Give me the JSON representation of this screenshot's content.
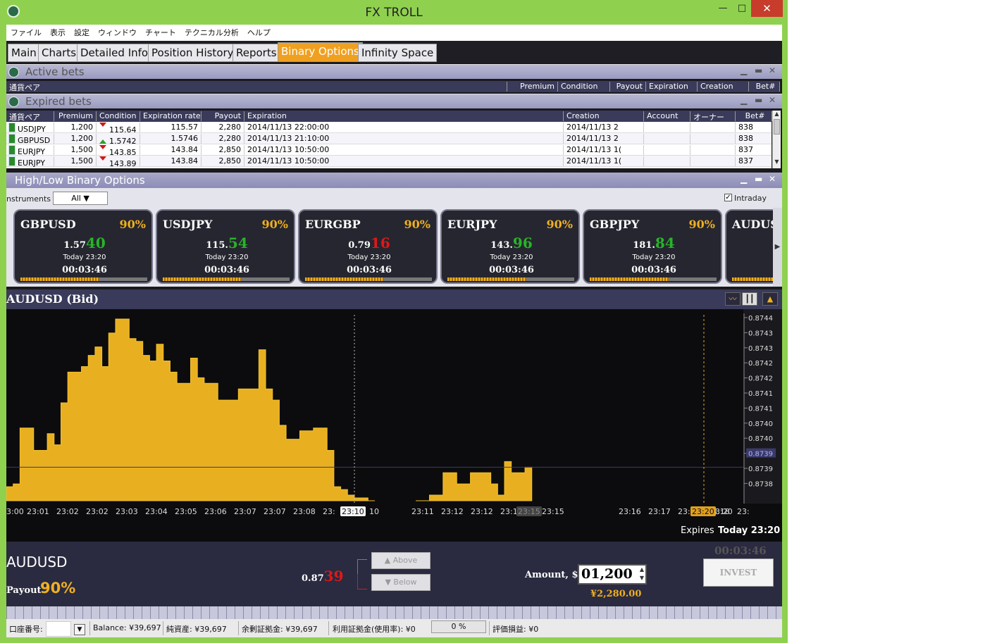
{
  "window": {
    "title": "FX TROLL",
    "min": "—",
    "max": "□",
    "close": "✕"
  },
  "menu": [
    "ファイル",
    "表示",
    "設定",
    "ウィンドウ",
    "チャート",
    "テクニカル分析",
    "ヘルプ"
  ],
  "tabs": [
    "Main",
    "Charts",
    "Detailed Info",
    "Position History",
    "Reports",
    "Binary Options",
    "Infinity Space"
  ],
  "active_tab": "Binary Options",
  "active_bets": {
    "title": "Active bets",
    "columns": [
      "通貨ペア",
      "Premium",
      "Condition",
      "Payout",
      "Expiration",
      "Creation",
      "Bet#"
    ]
  },
  "expired_bets": {
    "title": "Expired bets",
    "columns": [
      "通貨ペア",
      "Premium",
      "Condition",
      "Expiration rate",
      "Payout",
      "Expiration",
      "Creation",
      "Account",
      "オーナー",
      "Bet#"
    ],
    "rows": [
      {
        "pair": "USDJPY",
        "premium": "1,200",
        "dir": "down",
        "condition": "115.64",
        "rate": "115.57",
        "payout": "2,280",
        "expiration": "2014/11/13 22:00:00",
        "creation": "2014/11/13 2",
        "bet": "838"
      },
      {
        "pair": "GBPUSD",
        "premium": "1,200",
        "dir": "up",
        "condition": "1.5742",
        "rate": "1.5746",
        "payout": "2,280",
        "expiration": "2014/11/13 21:10:00",
        "creation": "2014/11/13 2",
        "bet": "838"
      },
      {
        "pair": "EURJPY",
        "premium": "1,500",
        "dir": "down",
        "condition": "143.85",
        "rate": "143.84",
        "payout": "2,850",
        "expiration": "2014/11/13 10:50:00",
        "creation": "2014/11/13 1(",
        "bet": "837"
      },
      {
        "pair": "EURJPY",
        "premium": "1,500",
        "dir": "down",
        "condition": "143.89",
        "rate": "143.84",
        "payout": "2,850",
        "expiration": "2014/11/13 10:50:00",
        "creation": "2014/11/13 1(",
        "bet": "837"
      }
    ]
  },
  "highlow": {
    "title": "High/Low Binary Options",
    "instruments_label": "nstruments",
    "instruments_value": "All",
    "intraday_label": "Intraday",
    "intraday_checked": "✓"
  },
  "cards": [
    {
      "symbol": "GBPUSD",
      "pct": "90%",
      "p1": "1.57",
      "p2": "40",
      "p2_color": "#28b428",
      "today": "Today 23:20",
      "timer": "00:03:46",
      "progress": 0.62
    },
    {
      "symbol": "USDJPY",
      "pct": "90%",
      "p1": "115.",
      "p2": "54",
      "p2_color": "#28b428",
      "today": "Today 23:20",
      "timer": "00:03:46",
      "progress": 0.62
    },
    {
      "symbol": "EURGBP",
      "pct": "90%",
      "p1": "0.79",
      "p2": "16",
      "p2_color": "#e01818",
      "today": "Today 23:20",
      "timer": "00:03:46",
      "progress": 0.62
    },
    {
      "symbol": "EURJPY",
      "pct": "90%",
      "p1": "143.",
      "p2": "96",
      "p2_color": "#28b428",
      "today": "Today 23:20",
      "timer": "00:03:46",
      "progress": 0.62
    },
    {
      "symbol": "GBPJPY",
      "pct": "90%",
      "p1": "181.",
      "p2": "84",
      "p2_color": "#28b428",
      "today": "Today 23:20",
      "timer": "00:03:46",
      "progress": 0.62
    },
    {
      "symbol": "AUDUS",
      "pct": "",
      "p1": "",
      "p2": "",
      "p2_color": "#28b428",
      "today": "",
      "timer": "",
      "progress": 0.62
    }
  ],
  "chart": {
    "title": "AUDUSD (Bid)",
    "expires_label": "Expires",
    "expires_value": "Today 23:20"
  },
  "chart_data": {
    "type": "area",
    "title": "AUDUSD (Bid)",
    "x_ticks": [
      "3:00",
      "23:01",
      "23:02",
      "23:02",
      "23:03",
      "23:04",
      "23:05",
      "23:06",
      "23:07",
      "23:07",
      "23:08",
      "23:",
      "23:10",
      "10",
      "23:11",
      "23:12",
      "23:12",
      "23:13",
      "23:",
      "23:15",
      "23:15",
      "23:16",
      "23:17",
      "23:17",
      "23:18",
      "23:",
      "23:20",
      "3:20"
    ],
    "y_ticks": [
      "0.8744",
      "0.8743",
      "0.8743",
      "0.8742",
      "0.8742",
      "0.8741",
      "0.8741",
      "0.8740",
      "0.8740",
      "0.8739",
      "0.8739",
      "0.8738"
    ],
    "current_price": "0.8739",
    "ylim": [
      0.87378,
      0.87444
    ],
    "series": [
      {
        "values": [
          0.87383,
          0.87384,
          0.87404,
          0.87404,
          0.87396,
          0.87396,
          0.87402,
          0.87398,
          0.87413,
          0.87424,
          0.87424,
          0.87426,
          0.8743,
          0.87433,
          0.87426,
          0.87438,
          0.87443,
          0.87443,
          0.87436,
          0.87435,
          0.8743,
          0.87428,
          0.87434,
          0.87428,
          0.87424,
          0.8742,
          0.8742,
          0.87429,
          0.87422,
          0.8742,
          0.8742,
          0.87414,
          0.87414,
          0.87414,
          0.87418,
          0.87418,
          0.87418,
          0.87432,
          0.87418,
          0.87414,
          0.87405,
          0.874,
          0.874,
          0.87403,
          0.87403,
          0.87404,
          0.87404,
          0.87396,
          0.87383,
          0.87382,
          0.8738,
          0.87379,
          0.87379,
          0.87378,
          null,
          null,
          null,
          null,
          null,
          null,
          0.87378,
          0.87378,
          0.8738,
          0.8738,
          0.87388,
          0.87388,
          0.87384,
          0.87384,
          0.87388,
          0.87388,
          0.87388,
          0.87384,
          0.8738,
          0.87392,
          0.87388,
          0.87388,
          0.8739
        ]
      }
    ]
  },
  "trade": {
    "symbol": "AUDUSD",
    "payout_label": "Payout",
    "payout_value": "90%",
    "price_p1": "0.87",
    "price_p2": "39",
    "above": "Above",
    "below": "Below",
    "amount_label": "Amount, $",
    "amount_value": "01,200",
    "payout_amount": "¥2,280.00",
    "timer": "00:03:46",
    "invest": "INVEST"
  },
  "status": {
    "account_label": "口座番号:",
    "balance": "Balance:  ¥39,697",
    "net": "純資産:  ¥39,697",
    "margin_free": "余剰証拠金:  ¥39,697",
    "margin_used": "利用証拠金(使用率):  ¥0",
    "usage": "0 %",
    "pl": "評価損益:  ¥0"
  }
}
